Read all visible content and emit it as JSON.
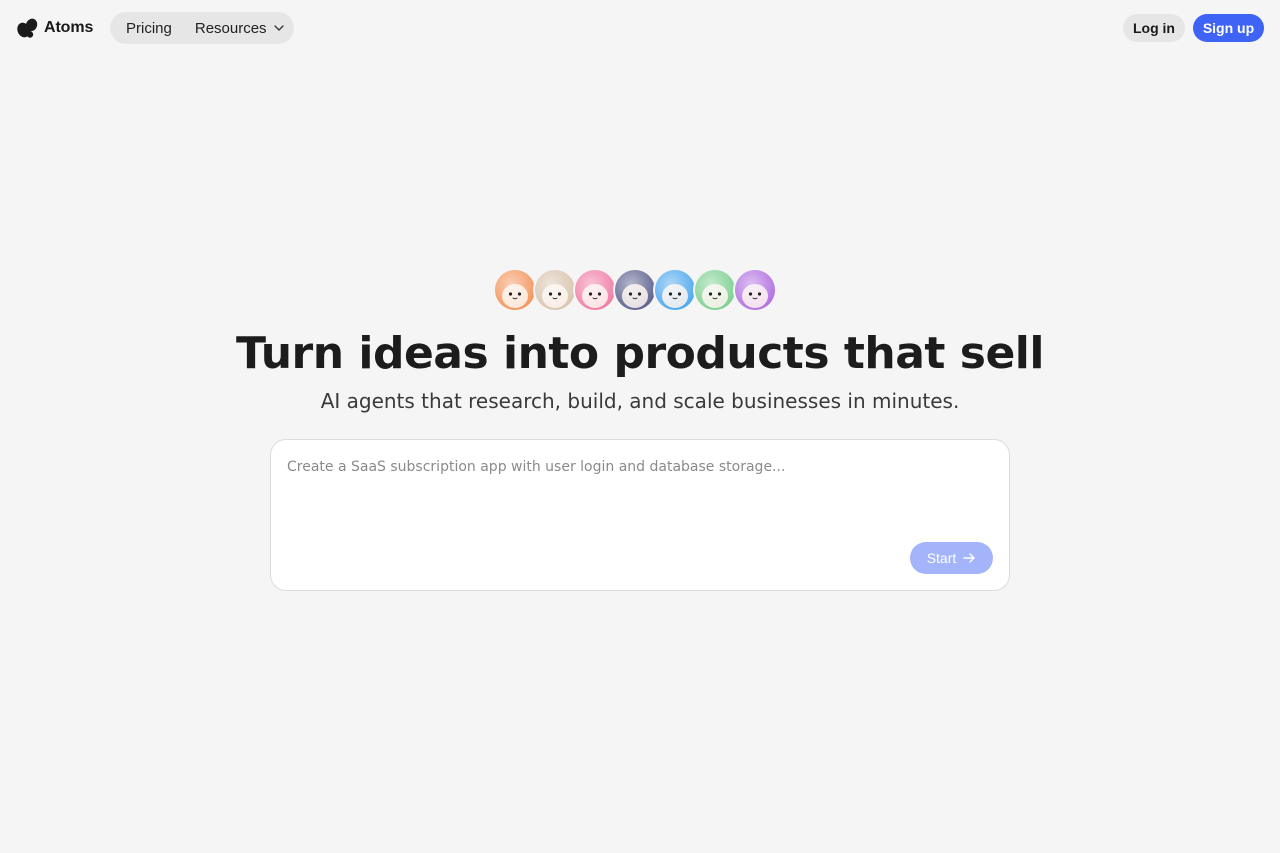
{
  "brand": {
    "name": "Atoms",
    "logo_icon": "atoms-logo-icon"
  },
  "nav": {
    "pricing_label": "Pricing",
    "resources_label": "Resources",
    "resources_icon": "chevron-down-icon"
  },
  "auth": {
    "login_label": "Log in",
    "signup_label": "Sign up"
  },
  "hero": {
    "agents": [
      {
        "name": "orange-agent-avatar",
        "color": "#f4935a"
      },
      {
        "name": "beige-agent-avatar",
        "color": "#d8c4ae"
      },
      {
        "name": "pink-agent-avatar",
        "color": "#f07aa4"
      },
      {
        "name": "navy-agent-avatar",
        "color": "#5a5f8c"
      },
      {
        "name": "blue-agent-avatar",
        "color": "#4aa6ee"
      },
      {
        "name": "green-agent-avatar",
        "color": "#7ccf8e"
      },
      {
        "name": "purple-agent-avatar",
        "color": "#b06ee0"
      }
    ],
    "headline": "Turn ideas into products that sell",
    "subheadline": "AI agents that research, build, and scale businesses in minutes."
  },
  "prompt": {
    "placeholder": "Create a SaaS subscription app with user login and database storage...",
    "value": "",
    "start_label": "Start",
    "start_icon": "arrow-right-icon"
  },
  "colors": {
    "background": "#f5f5f5",
    "accent": "#3e63f5",
    "start_disabled": "#a3b4fa"
  }
}
